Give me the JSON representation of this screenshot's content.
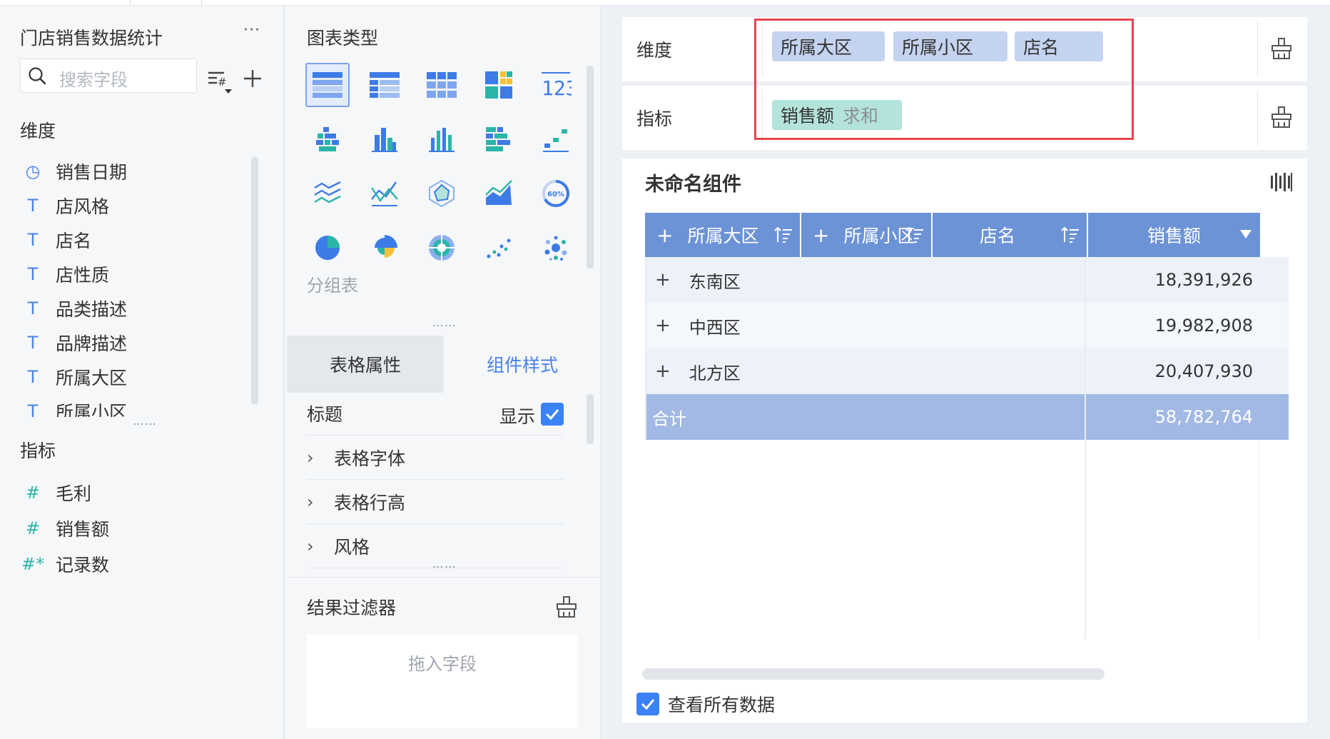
{
  "left": {
    "dataset_title": "门店销售数据统计",
    "more_label": "···",
    "search_placeholder": "搜索字段",
    "dimension_heading": "维度",
    "dimensions": [
      {
        "label": "销售日期",
        "icon": "clock-icon",
        "glyph": "◷"
      },
      {
        "label": "店风格",
        "icon": "text-type-icon",
        "glyph": "T"
      },
      {
        "label": "店名",
        "icon": "text-type-icon",
        "glyph": "T"
      },
      {
        "label": "店性质",
        "icon": "text-type-icon",
        "glyph": "T"
      },
      {
        "label": "品类描述",
        "icon": "text-type-icon",
        "glyph": "T"
      },
      {
        "label": "品牌描述",
        "icon": "text-type-icon",
        "glyph": "T"
      },
      {
        "label": "所属大区",
        "icon": "text-type-icon",
        "glyph": "T"
      },
      {
        "label": "所属小区",
        "icon": "text-type-icon",
        "glyph": "T"
      }
    ],
    "metric_heading": "指标",
    "metrics": [
      {
        "label": "毛利",
        "icon": "number-type-icon",
        "glyph": "#"
      },
      {
        "label": "销售额",
        "icon": "number-type-icon",
        "glyph": "#"
      },
      {
        "label": "记录数",
        "icon": "record-count-icon",
        "glyph": "#*"
      }
    ]
  },
  "middle": {
    "chart_type_heading": "图表类型",
    "selected_chart_caption": "分组表",
    "tabs": {
      "table_props": "表格属性",
      "component_style": "组件样式"
    },
    "title_row": {
      "label": "标题",
      "show_label": "显示",
      "checked": true
    },
    "expand_rows": [
      "表格字体",
      "表格行高",
      "风格"
    ],
    "result_filter_heading": "结果过滤器",
    "dropzone_text": "拖入字段"
  },
  "right": {
    "dimension_shelf": {
      "label": "维度",
      "pills": [
        "所属大区",
        "所属小区",
        "店名"
      ]
    },
    "metric_shelf": {
      "label": "指标",
      "pills": [
        {
          "field": "销售额",
          "agg": "求和"
        }
      ]
    },
    "component_title": "未命名组件",
    "table": {
      "headers": [
        "所属大区",
        "所属小区",
        "店名",
        "销售额"
      ],
      "rows": [
        {
          "region": "东南区",
          "value": "18,391,926"
        },
        {
          "region": "中西区",
          "value": "19,982,908"
        },
        {
          "region": "北方区",
          "value": "20,407,930"
        }
      ],
      "total": {
        "label": "合计",
        "value": "58,782,764"
      }
    },
    "view_all_label": "查看所有数据",
    "view_all_checked": true
  },
  "colors": {
    "accent": "#4b82e6",
    "table_header": "#6d93d7",
    "total_row": "#a2b9e4",
    "dim_pill": "#c4d3ef",
    "metric_pill": "#b3e3da",
    "highlight": "#e64550"
  }
}
